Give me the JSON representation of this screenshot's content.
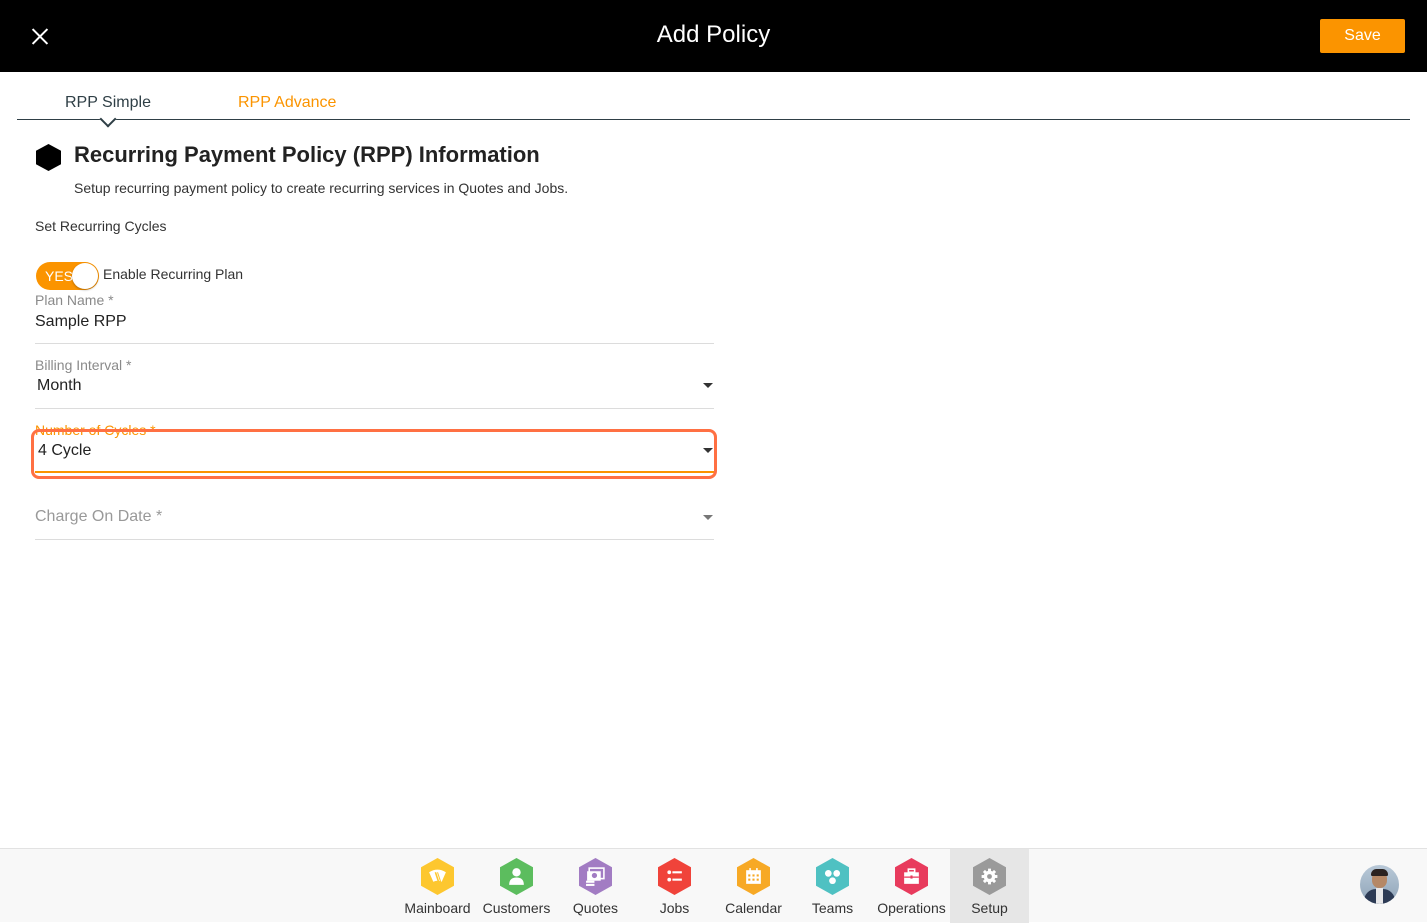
{
  "header": {
    "title": "Add Policy",
    "save_label": "Save",
    "close_icon": "close-icon"
  },
  "tabs": [
    {
      "label": "RPP Simple",
      "active": true
    },
    {
      "label": "RPP Advance",
      "active": false
    }
  ],
  "section": {
    "icon": "hexagon-icon",
    "title": "Recurring Payment Policy (RPP) Information",
    "subtitle": "Setup recurring payment policy to create recurring services in Quotes and Jobs.",
    "cycles_heading": "Set Recurring Cycles"
  },
  "toggle": {
    "state_label": "YES",
    "on": true,
    "label": "Enable Recurring Plan"
  },
  "fields": {
    "plan_name": {
      "label": "Plan Name *",
      "value": "Sample RPP"
    },
    "billing_interval": {
      "label": "Billing Interval *",
      "value": "Month"
    },
    "number_of_cycles": {
      "label": "Number of Cycles *",
      "value": "4 Cycle"
    },
    "charge_on_date": {
      "label": "Charge On Date *",
      "value": ""
    }
  },
  "colors": {
    "accent": "#fb9400",
    "highlight": "#ff7043",
    "header_bg": "#000000"
  },
  "nav": [
    {
      "label": "Mainboard",
      "icon": "windshield-icon",
      "color": "#fdc72f"
    },
    {
      "label": "Customers",
      "icon": "user-icon",
      "color": "#5cbd5e"
    },
    {
      "label": "Quotes",
      "icon": "money-icon",
      "color": "#a27cc3"
    },
    {
      "label": "Jobs",
      "icon": "list-icon",
      "color": "#f0433a"
    },
    {
      "label": "Calendar",
      "icon": "calendar-icon",
      "color": "#f7a925"
    },
    {
      "label": "Teams",
      "icon": "team-icon",
      "color": "#4fc1c2"
    },
    {
      "label": "Operations",
      "icon": "briefcase-icon",
      "color": "#e83b5d"
    },
    {
      "label": "Setup",
      "icon": "gear-icon",
      "color": "#9a9a9a",
      "active": true
    }
  ],
  "user": {
    "avatar_icon": "user-avatar"
  }
}
